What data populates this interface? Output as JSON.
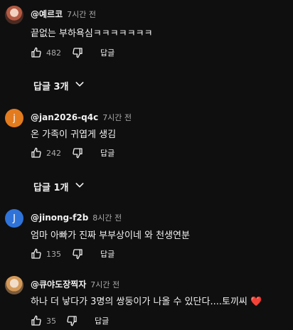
{
  "comments": [
    {
      "author": "@예르코",
      "time": "7시간 전",
      "text": "끝없는 부하욕심ㅋㅋㅋㅋㅋㅋㅋ",
      "likes": "482",
      "reply_label": "답글",
      "replies_label": "답글 3개",
      "avatar_icon": "avatar-photo"
    },
    {
      "author": "@jan2026-q4c",
      "time": "7시간 전",
      "text": "온 가족이 귀엽게 생김",
      "likes": "242",
      "reply_label": "답글",
      "replies_label": "답글 1개",
      "avatar_letter": "j",
      "avatar_color": "#e37b1f"
    },
    {
      "author": "@jinong-f2b",
      "time": "8시간 전",
      "text": "엄마 아빠가 진짜 부부상이네 와 천생연분",
      "likes": "135",
      "reply_label": "답글",
      "avatar_letter": "J",
      "avatar_color": "#2f73d9"
    },
    {
      "author": "@큐야도장찍자",
      "time": "7시간 전",
      "text": "하나 더 낳다가 3명의 쌍둥이가 나올 수 있단다....토끼씨",
      "text_emoji": "❤️",
      "likes": "35",
      "reply_label": "답글",
      "avatar_icon": "avatar-photo"
    }
  ],
  "icons": {
    "like": "thumbs-up-icon",
    "dislike": "thumbs-down-icon",
    "expand": "chevron-down-icon"
  }
}
